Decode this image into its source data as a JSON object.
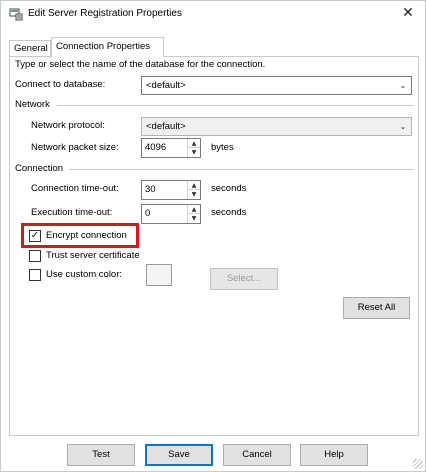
{
  "window": {
    "title": "Edit Server Registration Properties",
    "close_glyph": "✕"
  },
  "tabs": [
    {
      "label": "General",
      "selected": false
    },
    {
      "label": "Connection Properties",
      "selected": true
    }
  ],
  "instruction": "Type or select the name of the database for the connection.",
  "connect_to_database": {
    "label": "Connect to database:",
    "value": "<default>"
  },
  "network": {
    "group_label": "Network",
    "protocol": {
      "label": "Network protocol:",
      "value": "<default>"
    },
    "packet_size": {
      "label": "Network packet size:",
      "value": "4096",
      "unit": "bytes"
    }
  },
  "connection": {
    "group_label": "Connection",
    "timeout": {
      "label": "Connection time-out:",
      "value": "30",
      "unit": "seconds"
    },
    "exec_timeout": {
      "label": "Execution time-out:",
      "value": "0",
      "unit": "seconds"
    },
    "encrypt": {
      "label": "Encrypt connection",
      "checked": true
    },
    "trust_cert": {
      "label": "Trust server certificate",
      "checked": false
    },
    "custom_color": {
      "label": "Use custom color:",
      "checked": false
    },
    "select_button": "Select..."
  },
  "reset_all": "Reset All",
  "buttons": {
    "test": "Test",
    "save": "Save",
    "cancel": "Cancel",
    "help": "Help"
  },
  "colors": {
    "highlight": "#e0151c",
    "default_button_border": "#0078d7"
  },
  "glyphs": {
    "check": "✓",
    "dropdown": "⌄",
    "spin_up": "▲",
    "spin_down": "▼"
  }
}
